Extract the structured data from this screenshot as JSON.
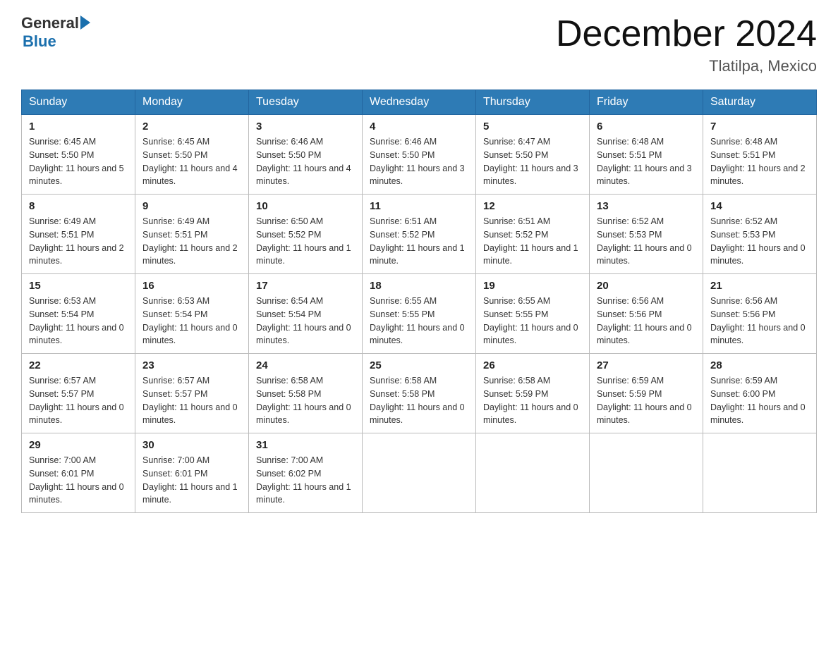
{
  "header": {
    "logo_general": "General",
    "logo_blue": "Blue",
    "title": "December 2024",
    "location": "Tlatilpa, Mexico"
  },
  "calendar": {
    "days_of_week": [
      "Sunday",
      "Monday",
      "Tuesday",
      "Wednesday",
      "Thursday",
      "Friday",
      "Saturday"
    ],
    "weeks": [
      [
        {
          "day": "1",
          "sunrise": "6:45 AM",
          "sunset": "5:50 PM",
          "daylight": "11 hours and 5 minutes."
        },
        {
          "day": "2",
          "sunrise": "6:45 AM",
          "sunset": "5:50 PM",
          "daylight": "11 hours and 4 minutes."
        },
        {
          "day": "3",
          "sunrise": "6:46 AM",
          "sunset": "5:50 PM",
          "daylight": "11 hours and 4 minutes."
        },
        {
          "day": "4",
          "sunrise": "6:46 AM",
          "sunset": "5:50 PM",
          "daylight": "11 hours and 3 minutes."
        },
        {
          "day": "5",
          "sunrise": "6:47 AM",
          "sunset": "5:50 PM",
          "daylight": "11 hours and 3 minutes."
        },
        {
          "day": "6",
          "sunrise": "6:48 AM",
          "sunset": "5:51 PM",
          "daylight": "11 hours and 3 minutes."
        },
        {
          "day": "7",
          "sunrise": "6:48 AM",
          "sunset": "5:51 PM",
          "daylight": "11 hours and 2 minutes."
        }
      ],
      [
        {
          "day": "8",
          "sunrise": "6:49 AM",
          "sunset": "5:51 PM",
          "daylight": "11 hours and 2 minutes."
        },
        {
          "day": "9",
          "sunrise": "6:49 AM",
          "sunset": "5:51 PM",
          "daylight": "11 hours and 2 minutes."
        },
        {
          "day": "10",
          "sunrise": "6:50 AM",
          "sunset": "5:52 PM",
          "daylight": "11 hours and 1 minute."
        },
        {
          "day": "11",
          "sunrise": "6:51 AM",
          "sunset": "5:52 PM",
          "daylight": "11 hours and 1 minute."
        },
        {
          "day": "12",
          "sunrise": "6:51 AM",
          "sunset": "5:52 PM",
          "daylight": "11 hours and 1 minute."
        },
        {
          "day": "13",
          "sunrise": "6:52 AM",
          "sunset": "5:53 PM",
          "daylight": "11 hours and 0 minutes."
        },
        {
          "day": "14",
          "sunrise": "6:52 AM",
          "sunset": "5:53 PM",
          "daylight": "11 hours and 0 minutes."
        }
      ],
      [
        {
          "day": "15",
          "sunrise": "6:53 AM",
          "sunset": "5:54 PM",
          "daylight": "11 hours and 0 minutes."
        },
        {
          "day": "16",
          "sunrise": "6:53 AM",
          "sunset": "5:54 PM",
          "daylight": "11 hours and 0 minutes."
        },
        {
          "day": "17",
          "sunrise": "6:54 AM",
          "sunset": "5:54 PM",
          "daylight": "11 hours and 0 minutes."
        },
        {
          "day": "18",
          "sunrise": "6:55 AM",
          "sunset": "5:55 PM",
          "daylight": "11 hours and 0 minutes."
        },
        {
          "day": "19",
          "sunrise": "6:55 AM",
          "sunset": "5:55 PM",
          "daylight": "11 hours and 0 minutes."
        },
        {
          "day": "20",
          "sunrise": "6:56 AM",
          "sunset": "5:56 PM",
          "daylight": "11 hours and 0 minutes."
        },
        {
          "day": "21",
          "sunrise": "6:56 AM",
          "sunset": "5:56 PM",
          "daylight": "11 hours and 0 minutes."
        }
      ],
      [
        {
          "day": "22",
          "sunrise": "6:57 AM",
          "sunset": "5:57 PM",
          "daylight": "11 hours and 0 minutes."
        },
        {
          "day": "23",
          "sunrise": "6:57 AM",
          "sunset": "5:57 PM",
          "daylight": "11 hours and 0 minutes."
        },
        {
          "day": "24",
          "sunrise": "6:58 AM",
          "sunset": "5:58 PM",
          "daylight": "11 hours and 0 minutes."
        },
        {
          "day": "25",
          "sunrise": "6:58 AM",
          "sunset": "5:58 PM",
          "daylight": "11 hours and 0 minutes."
        },
        {
          "day": "26",
          "sunrise": "6:58 AM",
          "sunset": "5:59 PM",
          "daylight": "11 hours and 0 minutes."
        },
        {
          "day": "27",
          "sunrise": "6:59 AM",
          "sunset": "5:59 PM",
          "daylight": "11 hours and 0 minutes."
        },
        {
          "day": "28",
          "sunrise": "6:59 AM",
          "sunset": "6:00 PM",
          "daylight": "11 hours and 0 minutes."
        }
      ],
      [
        {
          "day": "29",
          "sunrise": "7:00 AM",
          "sunset": "6:01 PM",
          "daylight": "11 hours and 0 minutes."
        },
        {
          "day": "30",
          "sunrise": "7:00 AM",
          "sunset": "6:01 PM",
          "daylight": "11 hours and 1 minute."
        },
        {
          "day": "31",
          "sunrise": "7:00 AM",
          "sunset": "6:02 PM",
          "daylight": "11 hours and 1 minute."
        },
        null,
        null,
        null,
        null
      ]
    ]
  },
  "labels": {
    "sunrise_prefix": "Sunrise: ",
    "sunset_prefix": "Sunset: ",
    "daylight_prefix": "Daylight: "
  }
}
